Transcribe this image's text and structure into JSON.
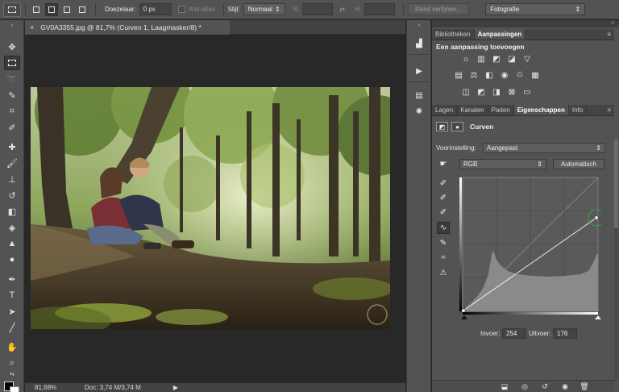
{
  "options_bar": {
    "feather_label": "Doezelaar:",
    "feather_value": "0 px",
    "antialias_label": "Anti-alias",
    "style_label": "Stijl:",
    "style_value": "Normaal",
    "width_label": "B:",
    "height_label": "H:",
    "refine_button": "Rand verfijnen...",
    "workspace": "Fotografie"
  },
  "document": {
    "tab_title": "GV0A3355.jpg @ 81,7% (Curven 1, Laagmasker/8) *",
    "close_glyph": "×"
  },
  "status_bar": {
    "zoom": "81,68%",
    "doc_size": "Doc: 3,74 M/3,74 M",
    "arrow": "▶"
  },
  "panels": {
    "top_tabs": [
      "Bibliotheken",
      "Aanpassingen"
    ],
    "top_active": "Aanpassingen",
    "add_adjustment_title": "Een aanpassing toevoegen",
    "mid_tabs": [
      "Lagen",
      "Kanalen",
      "Paden",
      "Eigenschappen",
      "Info"
    ],
    "mid_active": "Eigenschappen",
    "menu_glyph": "≡",
    "properties": {
      "title": "Curven",
      "preset_label": "Voorinstelling:",
      "preset_value": "Aangepast",
      "channel_value": "RGB",
      "auto_button": "Automatisch",
      "input_label": "Invoer:",
      "input_value": "254",
      "output_label": "Uitvoer:",
      "output_value": "176"
    }
  },
  "colors": {
    "panel_bg": "#535353",
    "curve_selection": "#3aa84a",
    "foreground": "#000000",
    "background": "#ffffff"
  },
  "curve": {
    "points": [
      [
        0,
        0
      ],
      [
        254,
        176
      ]
    ]
  },
  "icons": {
    "adjustments_row1": [
      "brightness-icon",
      "levels-icon",
      "curves-icon",
      "exposure-icon",
      "vibrance-icon"
    ],
    "adjustments_row2": [
      "hue-saturation-icon",
      "color-balance-icon",
      "black-white-icon",
      "photo-filter-icon",
      "channel-mixer-icon",
      "color-lookup-icon"
    ],
    "adjustments_row3": [
      "invert-icon",
      "posterize-icon",
      "threshold-icon",
      "selective-color-icon",
      "gradient-map-icon"
    ]
  }
}
